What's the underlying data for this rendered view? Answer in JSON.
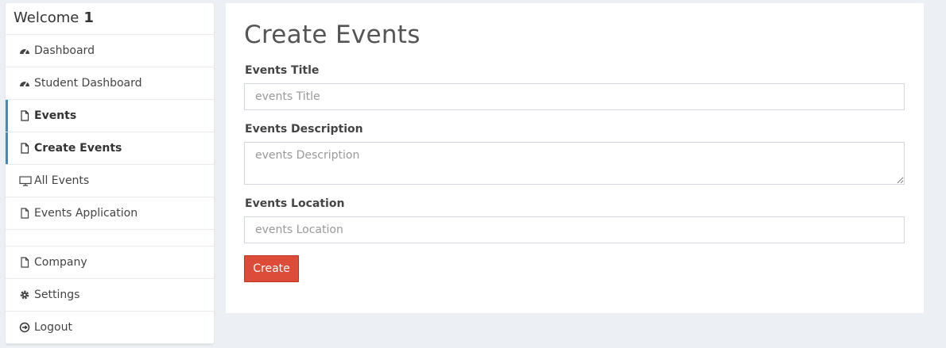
{
  "sidebar": {
    "welcome_text": "Welcome",
    "user_name": "1",
    "items": [
      {
        "label": "Dashboard",
        "icon": "dashboard-icon",
        "active": false
      },
      {
        "label": "Student Dashboard",
        "icon": "dashboard-icon",
        "active": false
      },
      {
        "label": "Events",
        "icon": "file-icon",
        "active": true
      },
      {
        "label": "Create Events",
        "icon": "file-icon",
        "active": true
      },
      {
        "label": "All Events",
        "icon": "desktop-icon",
        "active": false
      },
      {
        "label": "Events Application",
        "icon": "file-icon",
        "active": false
      },
      {
        "label": "Company",
        "icon": "file-icon",
        "active": false
      },
      {
        "label": "Settings",
        "icon": "gear-icon",
        "active": false
      },
      {
        "label": "Logout",
        "icon": "logout-icon",
        "active": false
      }
    ]
  },
  "main": {
    "title": "Create Events",
    "form": {
      "title_label": "Events Title",
      "title_placeholder": "events Title",
      "description_label": "Events Description",
      "description_placeholder": "events Description",
      "location_label": "Events Location",
      "location_placeholder": "events Location",
      "submit_label": "Create"
    }
  },
  "colors": {
    "accent": "#3c8dbc",
    "button": "#dd4b39",
    "background": "#eceff3"
  }
}
